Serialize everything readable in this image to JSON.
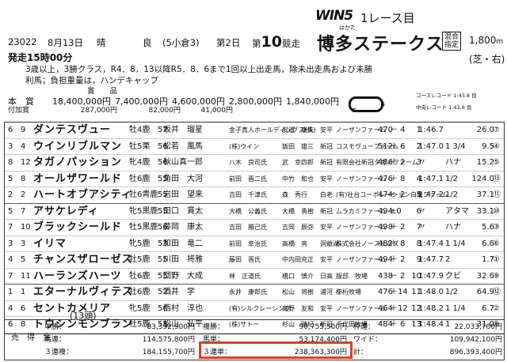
{
  "header": {
    "win5": "WIN5",
    "race_label": "1レース目",
    "race_id": "23022",
    "date": "8月13日",
    "weather": "晴",
    "track_condition": "良",
    "meeting": "(5小倉3)",
    "day": "第2日",
    "race_no_prefix": "第",
    "race_no": "10",
    "race_no_suffix": "競走",
    "race_name_furigana": "はかた",
    "race_name": "博多ステークス",
    "badge_top": "混合",
    "badge_bottom": "指定",
    "distance": "1,800",
    "distance_unit": "m",
    "course": "(芝・右)",
    "start_time": "発走15時00分",
    "conditions_1": "3歳以上，3勝クラス，R4．8．13以降R5．8．6まで1回以上出走馬，除未出走馬および未勝",
    "conditions_2": "利馬；負担重量は，ハンデキャップ"
  },
  "prizes": {
    "title": "賞　　品",
    "main_label": "本　賞",
    "main": [
      "18,400,000円",
      "7,400,000円",
      "4,600,000円",
      "2,800,000円",
      "1,840,000円"
    ],
    "extra_label": "付加賞",
    "extra": [
      "287,000円",
      "82,000円",
      "41,000円"
    ]
  },
  "records": {
    "course_record": "コースレコード 1:43.8 良",
    "middle_record": "中央レコード 1:43.8 良",
    "diagram_g": "G",
    "diagram_s": "S"
  },
  "horses": [
    {
      "waku": "6",
      "no": "9",
      "name": "ダンテスヴュー",
      "sex_age": "牡4鹿",
      "weight": "57",
      "jockey": "坂井　瑠星",
      "owner": "金子真人ホールディングス(株)",
      "trainer": "友道　康夫",
      "region": "安平",
      "breeder": "ノーザンファーム",
      "body": "470",
      "diff": "－ 4",
      "pos": "1",
      "time": "1:46.7",
      "margin": "",
      "odds": "26.0",
      "pop": "⑦"
    },
    {
      "waku": "3",
      "no": "4",
      "name": "ウインリブルマン",
      "sex_age": "牡5栗",
      "weight": "56",
      "jockey": "松若　風馬",
      "owner": "(株)ウイン",
      "trainer": "飯田　雄三",
      "region": "新冠",
      "breeder": "コスモヴューファーム",
      "body": "512",
      "diff": "＋ 6",
      "pos": "2",
      "time": "1:47.0",
      "margin": "1 3/4",
      "odds": "9.5",
      "pop": "④"
    },
    {
      "waku": "8",
      "no": "12",
      "name": "タガノパッション",
      "sex_age": "牝4鹿",
      "weight": "56",
      "jockey": "秋山真一郎",
      "owner": "八木　良司氏",
      "trainer": "武　幸四郎",
      "region": "新冠",
      "breeder": "有限会社新冠タガノファーム",
      "body": "486",
      "diff": "＋ 2",
      "pos": "3",
      "time": "〃",
      "margin": "ハナ",
      "odds": "15.2",
      "pop": "⑤"
    },
    {
      "waku": "5",
      "no": "8",
      "name": "オールザワールド",
      "sex_age": "牡6鹿",
      "weight": "55",
      "jockey": "角田　大河",
      "owner": "前田　晋二氏",
      "trainer": "中竹　和也",
      "region": "安平",
      "breeder": "ノーザンファーム",
      "body": "476",
      "diff": "＋ 8",
      "pos": "4",
      "time": "1:47.1",
      "margin": "1/2",
      "odds": "124.0",
      "pop": "⑬"
    },
    {
      "waku": "2",
      "no": "2",
      "name": "ハートオブアシティ",
      "sex_age": "牡6青鹿",
      "weight": "55",
      "jockey": "岩田　望来",
      "owner": "吉田　千津氏",
      "trainer": "森　秀行",
      "region": "白老",
      "breeder": "(有)社台コーポレーション白老ファーム",
      "body": "474",
      "diff": "－ 2",
      "pos": "5",
      "time": "1:47.2",
      "margin": "1/2",
      "odds": "37.1",
      "pop": "⑪"
    },
    {
      "waku": "5",
      "no": "7",
      "name": "アサケレディ",
      "sex_age": "牝5黒鹿",
      "weight": "55",
      "jockey": "田口　貫太",
      "owner": "大橋　公義氏",
      "trainer": "大橋　勇樹",
      "region": "新冠",
      "breeder": "ムラカミファーム",
      "body": "494",
      "diff": "±0",
      "pos": "6",
      "time": "〃",
      "margin": "アタマ",
      "odds": "33.1",
      "pop": "⑩"
    },
    {
      "waku": "7",
      "no": "10",
      "name": "ブラックシールド",
      "sex_age": "牡5黒鹿",
      "weight": "56",
      "jockey": "藤岡　康太",
      "owner": "吉田　勝己氏",
      "trainer": "吉岡　辰弥",
      "region": "安平",
      "breeder": "ノーザンファーム",
      "body": "498",
      "diff": "＋ 2",
      "pos": "7",
      "time": "〃",
      "margin": "ハナ",
      "odds": "5.6",
      "pop": "③"
    },
    {
      "waku": "3",
      "no": "3",
      "name": "イリマ",
      "sex_age": "牝5鹿",
      "weight": "53",
      "jockey": "和田　竜二",
      "owner": "前田　幸治氏",
      "trainer": "高橋　亮",
      "region": "洞爺湖",
      "breeder": "株式会社ノースヒルズ",
      "body": "482",
      "diff": "＋ 8",
      "pos": "8",
      "time": "1:47.4",
      "margin": "1 1/4",
      "odds": "6.6",
      "pop": "⑥"
    },
    {
      "waku": "4",
      "no": "5",
      "name": "チャンスザローゼス",
      "sex_age": "牡5鹿",
      "weight": "55",
      "jockey": "川田　将雅",
      "owner": "藤田　晋氏",
      "trainer": "中内田充正",
      "region": "安平",
      "breeder": "ノーザンファーム",
      "body": "494",
      "diff": "＋ 2",
      "pos": "9",
      "time": "1:47.7",
      "margin": "2",
      "odds": "1.7",
      "pop": "①"
    },
    {
      "waku": "7",
      "no": "11",
      "name": "ハーランズハーツ",
      "sex_age": "牡6鹿",
      "weight": "55",
      "jockey": "団野　大成",
      "owner": "林　正道氏",
      "trainer": "橋口　慎介",
      "region": "日高",
      "breeder": "服部　牧場",
      "body": "438",
      "diff": "－ 2",
      "pos": "10",
      "time": "1:47.9",
      "margin": "クビ",
      "odds": "32.6",
      "pop": "⑨"
    },
    {
      "waku": "1",
      "no": "1",
      "name": "エターナルヴィテス",
      "sex_age": "牡6鹿",
      "weight": "52",
      "jockey": "酒井　学",
      "owner": "永井　康郎氏",
      "trainer": "松山　将樹",
      "region": "浦河",
      "breeder": "櫛桁牧場",
      "body": "476",
      "diff": "＋14",
      "pos": "11",
      "time": "1:48.0",
      "margin": "1/2",
      "odds": "64.9",
      "pop": "⑫"
    },
    {
      "waku": "4",
      "no": "6",
      "name": "セントカメリア",
      "sex_age": "牝5鹿",
      "weight": "56",
      "jockey": "西村　淳也",
      "owner": "(有)シルクレーシング",
      "trainer": "高野　友和",
      "region": "安平",
      "breeder": "ノーザンファーム",
      "body": "464",
      "diff": "＋12",
      "pos": "12",
      "time": "1:48.2",
      "margin": "1 1/4",
      "odds": "6.7",
      "pop": "②"
    },
    {
      "waku": "6",
      "no": "8",
      "name": "トウシンモンブラン",
      "sex_age": "牡5鹿",
      "weight": "55",
      "jockey": "松山　弘平",
      "owner": "(株)サトー",
      "trainer": "杉山　晴紀",
      "region": "新冠",
      "breeder": "千代田牧場",
      "body": "484",
      "diff": "＋ 6",
      "pos": "13",
      "time": "1:48.4",
      "margin": "1",
      "odds": "31.0",
      "pop": "⑧"
    }
  ],
  "horse_count": "(13頭)",
  "payout": {
    "section_label": "売　得　金",
    "rows": [
      [
        {
          "label": "単勝：",
          "value": "83,392,900円"
        },
        {
          "label": "複勝：",
          "value": "90,755,500円"
        },
        {
          "label": "枠連：",
          "value": "22,033,700円"
        }
      ],
      [
        {
          "label": "馬連：",
          "value": "114,575,800円"
        },
        {
          "label": "馬単：",
          "value": "53,174,400円"
        },
        {
          "label": "ワイド：",
          "value": "109,942,100円"
        }
      ],
      [
        {
          "label": "３連複：",
          "value": "184,155,700円"
        },
        {
          "label": "３連単：",
          "value": "238,363,300円"
        },
        {
          "label": "計：",
          "value": "896,393,400円"
        }
      ]
    ]
  },
  "colors": {
    "highlight": "#e43d20"
  }
}
